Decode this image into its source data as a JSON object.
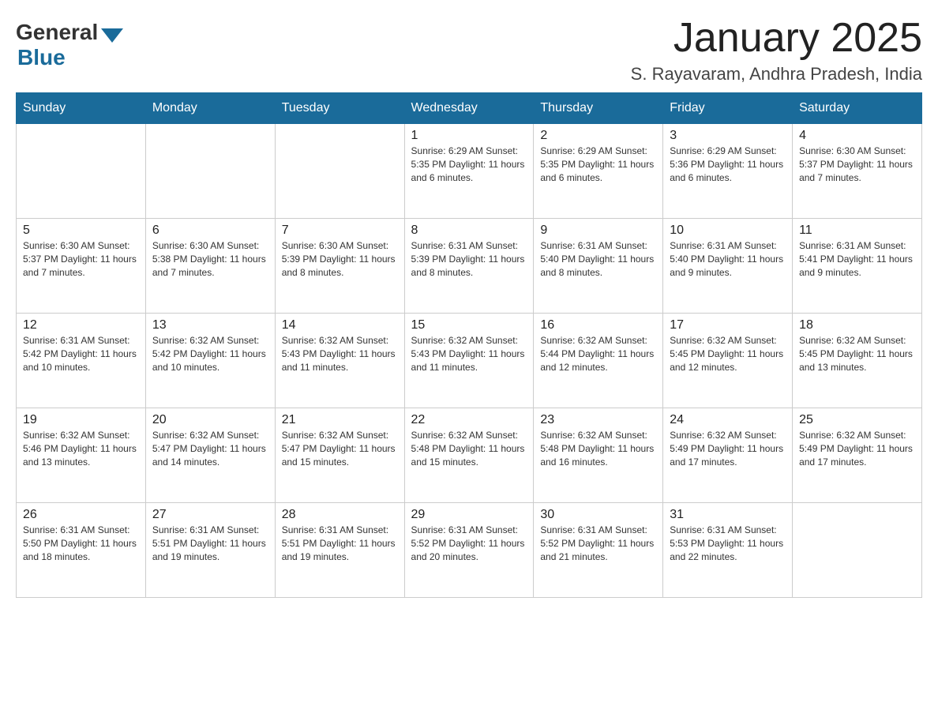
{
  "logo": {
    "general": "General",
    "blue": "Blue"
  },
  "title": "January 2025",
  "location": "S. Rayavaram, Andhra Pradesh, India",
  "headers": [
    "Sunday",
    "Monday",
    "Tuesday",
    "Wednesday",
    "Thursday",
    "Friday",
    "Saturday"
  ],
  "weeks": [
    [
      {
        "day": "",
        "info": ""
      },
      {
        "day": "",
        "info": ""
      },
      {
        "day": "",
        "info": ""
      },
      {
        "day": "1",
        "info": "Sunrise: 6:29 AM\nSunset: 5:35 PM\nDaylight: 11 hours and 6 minutes."
      },
      {
        "day": "2",
        "info": "Sunrise: 6:29 AM\nSunset: 5:35 PM\nDaylight: 11 hours and 6 minutes."
      },
      {
        "day": "3",
        "info": "Sunrise: 6:29 AM\nSunset: 5:36 PM\nDaylight: 11 hours and 6 minutes."
      },
      {
        "day": "4",
        "info": "Sunrise: 6:30 AM\nSunset: 5:37 PM\nDaylight: 11 hours and 7 minutes."
      }
    ],
    [
      {
        "day": "5",
        "info": "Sunrise: 6:30 AM\nSunset: 5:37 PM\nDaylight: 11 hours and 7 minutes."
      },
      {
        "day": "6",
        "info": "Sunrise: 6:30 AM\nSunset: 5:38 PM\nDaylight: 11 hours and 7 minutes."
      },
      {
        "day": "7",
        "info": "Sunrise: 6:30 AM\nSunset: 5:39 PM\nDaylight: 11 hours and 8 minutes."
      },
      {
        "day": "8",
        "info": "Sunrise: 6:31 AM\nSunset: 5:39 PM\nDaylight: 11 hours and 8 minutes."
      },
      {
        "day": "9",
        "info": "Sunrise: 6:31 AM\nSunset: 5:40 PM\nDaylight: 11 hours and 8 minutes."
      },
      {
        "day": "10",
        "info": "Sunrise: 6:31 AM\nSunset: 5:40 PM\nDaylight: 11 hours and 9 minutes."
      },
      {
        "day": "11",
        "info": "Sunrise: 6:31 AM\nSunset: 5:41 PM\nDaylight: 11 hours and 9 minutes."
      }
    ],
    [
      {
        "day": "12",
        "info": "Sunrise: 6:31 AM\nSunset: 5:42 PM\nDaylight: 11 hours and 10 minutes."
      },
      {
        "day": "13",
        "info": "Sunrise: 6:32 AM\nSunset: 5:42 PM\nDaylight: 11 hours and 10 minutes."
      },
      {
        "day": "14",
        "info": "Sunrise: 6:32 AM\nSunset: 5:43 PM\nDaylight: 11 hours and 11 minutes."
      },
      {
        "day": "15",
        "info": "Sunrise: 6:32 AM\nSunset: 5:43 PM\nDaylight: 11 hours and 11 minutes."
      },
      {
        "day": "16",
        "info": "Sunrise: 6:32 AM\nSunset: 5:44 PM\nDaylight: 11 hours and 12 minutes."
      },
      {
        "day": "17",
        "info": "Sunrise: 6:32 AM\nSunset: 5:45 PM\nDaylight: 11 hours and 12 minutes."
      },
      {
        "day": "18",
        "info": "Sunrise: 6:32 AM\nSunset: 5:45 PM\nDaylight: 11 hours and 13 minutes."
      }
    ],
    [
      {
        "day": "19",
        "info": "Sunrise: 6:32 AM\nSunset: 5:46 PM\nDaylight: 11 hours and 13 minutes."
      },
      {
        "day": "20",
        "info": "Sunrise: 6:32 AM\nSunset: 5:47 PM\nDaylight: 11 hours and 14 minutes."
      },
      {
        "day": "21",
        "info": "Sunrise: 6:32 AM\nSunset: 5:47 PM\nDaylight: 11 hours and 15 minutes."
      },
      {
        "day": "22",
        "info": "Sunrise: 6:32 AM\nSunset: 5:48 PM\nDaylight: 11 hours and 15 minutes."
      },
      {
        "day": "23",
        "info": "Sunrise: 6:32 AM\nSunset: 5:48 PM\nDaylight: 11 hours and 16 minutes."
      },
      {
        "day": "24",
        "info": "Sunrise: 6:32 AM\nSunset: 5:49 PM\nDaylight: 11 hours and 17 minutes."
      },
      {
        "day": "25",
        "info": "Sunrise: 6:32 AM\nSunset: 5:49 PM\nDaylight: 11 hours and 17 minutes."
      }
    ],
    [
      {
        "day": "26",
        "info": "Sunrise: 6:31 AM\nSunset: 5:50 PM\nDaylight: 11 hours and 18 minutes."
      },
      {
        "day": "27",
        "info": "Sunrise: 6:31 AM\nSunset: 5:51 PM\nDaylight: 11 hours and 19 minutes."
      },
      {
        "day": "28",
        "info": "Sunrise: 6:31 AM\nSunset: 5:51 PM\nDaylight: 11 hours and 19 minutes."
      },
      {
        "day": "29",
        "info": "Sunrise: 6:31 AM\nSunset: 5:52 PM\nDaylight: 11 hours and 20 minutes."
      },
      {
        "day": "30",
        "info": "Sunrise: 6:31 AM\nSunset: 5:52 PM\nDaylight: 11 hours and 21 minutes."
      },
      {
        "day": "31",
        "info": "Sunrise: 6:31 AM\nSunset: 5:53 PM\nDaylight: 11 hours and 22 minutes."
      },
      {
        "day": "",
        "info": ""
      }
    ]
  ]
}
